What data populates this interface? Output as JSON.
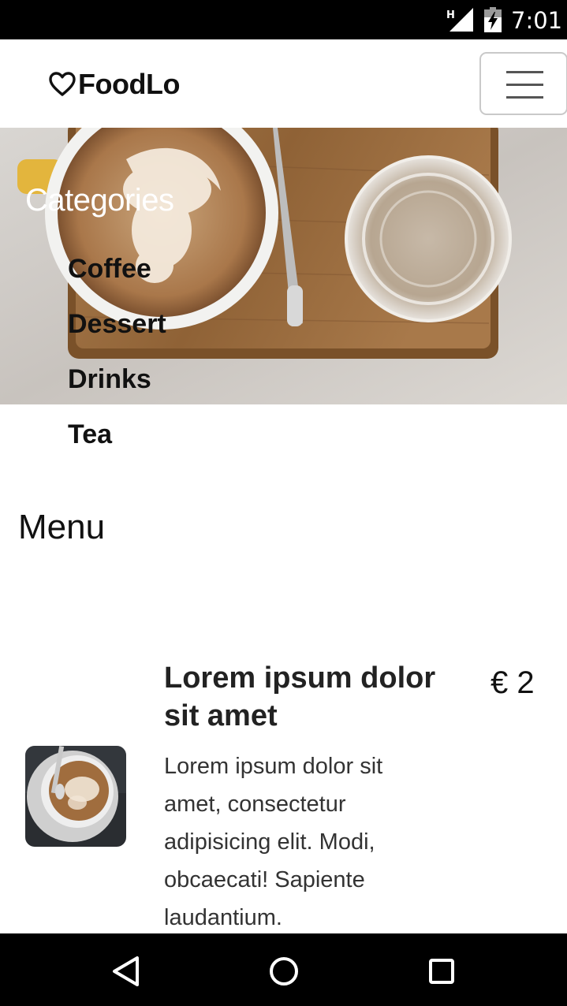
{
  "status_bar": {
    "network": "H",
    "time": "7:01"
  },
  "navbar": {
    "brand": "FoodLo",
    "brand_icon": "heart-outline-icon",
    "toggler_icon": "hamburger-menu-icon"
  },
  "categories": {
    "title": "Categories",
    "items": [
      "Coffee",
      "Dessert",
      "Drinks",
      "Tea"
    ]
  },
  "menu": {
    "heading": "Menu",
    "items": [
      {
        "title": "Lorem ipsum dolor sit amet",
        "price": "€ 2",
        "description": "Lorem ipsum dolor sit amet, consectetur adipisicing elit. Modi, obcaecati! Sapiente laudantium."
      }
    ]
  },
  "colors": {
    "status_bar": "#000000",
    "nav_bar": "#000000",
    "toggler_border": "#c9c9c9"
  }
}
